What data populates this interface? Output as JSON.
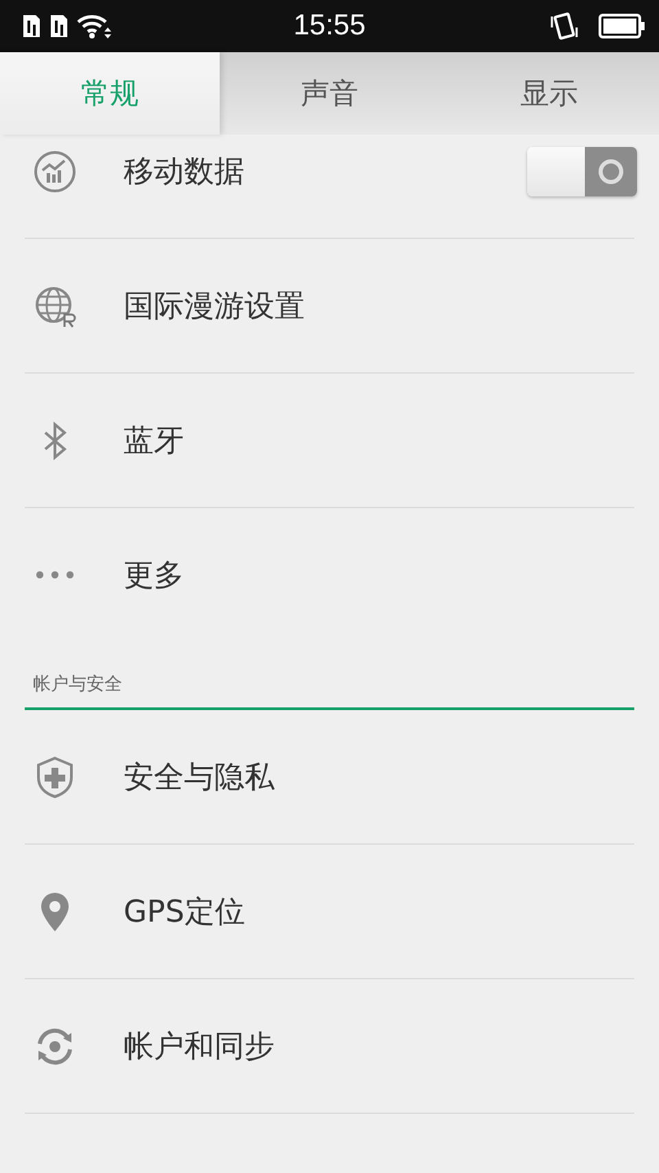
{
  "status_bar": {
    "time": "15:55"
  },
  "tabs": [
    {
      "label": "常规",
      "selected": true
    },
    {
      "label": "声音",
      "selected": false
    },
    {
      "label": "显示",
      "selected": false
    }
  ],
  "sections": [
    {
      "items": [
        {
          "label": "移动数据",
          "kind": "toggle",
          "on": false
        },
        {
          "label": "国际漫游设置",
          "kind": "link"
        },
        {
          "label": "蓝牙",
          "kind": "link"
        },
        {
          "label": "更多",
          "kind": "link"
        }
      ]
    },
    {
      "header": "帐户与安全",
      "items": [
        {
          "label": "安全与隐私",
          "kind": "link"
        },
        {
          "label": "GPS定位",
          "kind": "link"
        },
        {
          "label": "帐户和同步",
          "kind": "link"
        }
      ]
    }
  ]
}
